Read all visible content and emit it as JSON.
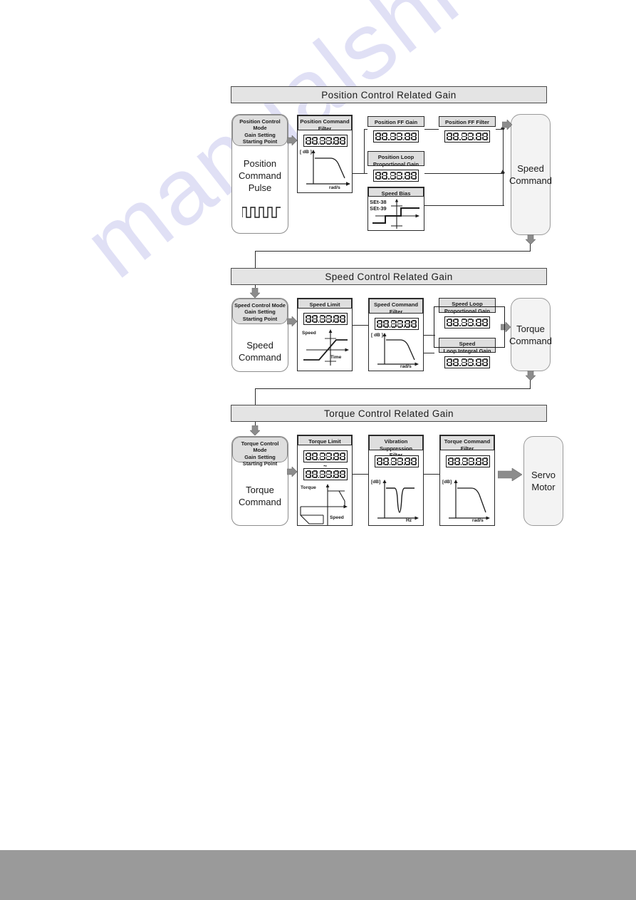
{
  "page": {
    "watermark_text": "manualshive.com",
    "footer_color": "#9a9a9a"
  },
  "sections": [
    {
      "id": "position",
      "header": "Position Control Related Gain",
      "start_capsule": {
        "title": "Position Control\nMode\nGain Setting\nStarting Point",
        "title_lines": [
          "Position Control",
          "Mode",
          "Gain Setting",
          "Starting Point"
        ],
        "body_lines": [
          "Position",
          "Command",
          "Pulse"
        ],
        "has_pulse_train": true
      },
      "modules": [
        {
          "id": "position-command-filter",
          "title_lines": [
            "Position Command",
            "Filter"
          ],
          "display": "7seg-6digit",
          "graph": {
            "type": "lowpass",
            "ylabel": "[ dB ]",
            "xlabel": "rad/s"
          }
        },
        {
          "id": "position-ff-gain",
          "title_lines": [
            "Position FF Gain"
          ],
          "display": "7seg-6digit",
          "graph": null
        },
        {
          "id": "position-ff-filter",
          "title_lines": [
            "Position FF Filter"
          ],
          "display": "7seg-6digit",
          "graph": null
        },
        {
          "id": "position-loop-proportional-gain",
          "title_lines": [
            "Position Loop",
            "Proportional Gain"
          ],
          "display": "7seg-6digit",
          "graph": null
        },
        {
          "id": "speed-bias",
          "title_lines": [
            "Speed Bias"
          ],
          "display": null,
          "param_labels": [
            "SEt-38",
            "SEt-39"
          ],
          "graph": {
            "type": "deadband-step",
            "ylabel": "",
            "xlabel": ""
          }
        }
      ],
      "terminal": {
        "id": "speed-command",
        "lines": [
          "Speed",
          "Command"
        ]
      }
    },
    {
      "id": "speed",
      "header": "Speed Control Related Gain",
      "start_capsule": {
        "title_lines": [
          "Speed Control Mode",
          "Gain Setting",
          "Starting Point"
        ],
        "body_lines": [
          "Speed",
          "Command"
        ],
        "has_pulse_train": false
      },
      "modules": [
        {
          "id": "speed-limit",
          "title_lines": [
            "Speed Limit"
          ],
          "display": "7seg-6digit",
          "graph": {
            "type": "ramp",
            "ylabel": "Speed",
            "xlabel": "Time"
          }
        },
        {
          "id": "speed-command-filter",
          "title_lines": [
            "Speed Command",
            "Filter"
          ],
          "display": "7seg-6digit",
          "graph": {
            "type": "lowpass",
            "ylabel": "[ dB ]",
            "xlabel": "rad/s"
          }
        },
        {
          "id": "speed-loop-proportional-gain",
          "title_lines": [
            "Speed Loop",
            "Proportional Gain"
          ],
          "display": "7seg-6digit",
          "graph": null
        },
        {
          "id": "speed-loop-integral-gain",
          "title_lines": [
            "Speed",
            "Loop Integral Gain"
          ],
          "display": "7seg-6digit",
          "graph": null
        }
      ],
      "terminal": {
        "id": "torque-command",
        "lines": [
          "Torque",
          "Command"
        ]
      }
    },
    {
      "id": "torque",
      "header": "Torque Control Related Gain",
      "start_capsule": {
        "title_lines": [
          "Torque Control Mode",
          "Gain Setting",
          "Starting Point"
        ],
        "body_lines": [
          "Torque",
          "Command"
        ],
        "has_pulse_train": false
      },
      "modules": [
        {
          "id": "torque-limit",
          "title_lines": [
            "Torque Limit"
          ],
          "display": "7seg-6digit-pair",
          "separator": "~",
          "graph": {
            "type": "torque-speed",
            "ylabel": "Torque",
            "xlabel": "Speed"
          }
        },
        {
          "id": "vibration-suppression-filter",
          "title_lines": [
            "Vibration Suppression",
            "Filter"
          ],
          "display": "7seg-6digit",
          "graph": {
            "type": "notch",
            "ylabel": "[dB]",
            "xlabel": "Hz"
          }
        },
        {
          "id": "torque-command-filter",
          "title_lines": [
            "Torque Command",
            "Filter"
          ],
          "display": "7seg-6digit",
          "graph": {
            "type": "lowpass",
            "ylabel": "[dB]",
            "xlabel": "rad/s"
          }
        }
      ],
      "terminal": {
        "id": "servo-motor",
        "lines": [
          "Servo",
          "Motor"
        ]
      }
    }
  ]
}
